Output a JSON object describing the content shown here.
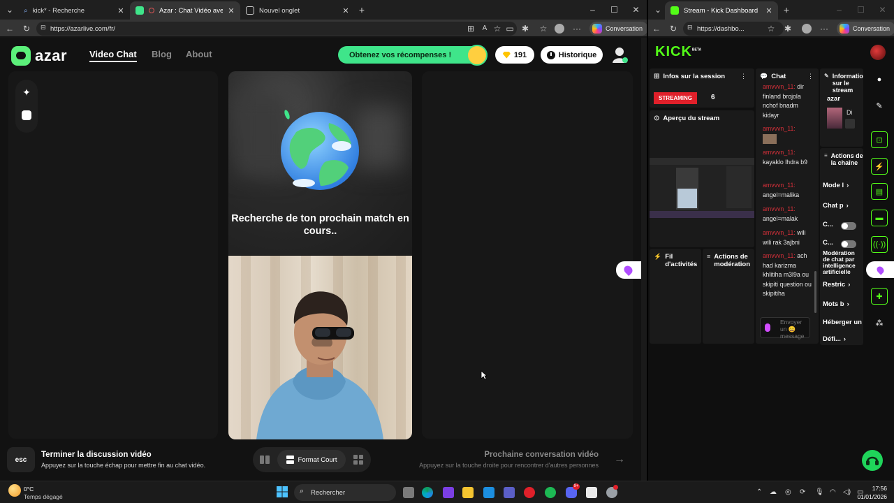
{
  "left_browser": {
    "tabs": [
      {
        "title": "kick* - Recherche",
        "active": false
      },
      {
        "title": "Azar : Chat Vidéo avec de no",
        "active": true
      },
      {
        "title": "Nouvel onglet",
        "active": false
      }
    ],
    "url": "https://azarlive.com/fr/",
    "conversation_label": "Conversation"
  },
  "azar": {
    "logo": "azar",
    "nav": [
      "Video Chat",
      "Blog",
      "About"
    ],
    "reward_label": "Obtenez vos récompenses !",
    "gems_count": "191",
    "history_label": "Historique",
    "searching_text": "Recherche de ton prochain match en cours..",
    "esc_key": "esc",
    "end_title": "Terminer la discussion vidéo",
    "end_sub": "Appuyez sur la touche échap pour mettre fin au chat vidéo.",
    "format_label": "Format Court",
    "next_title": "Prochaine conversation vidéo",
    "next_sub": "Appuyez sur la touche droite pour rencontrer d'autres personnes"
  },
  "right_browser": {
    "tab_title": "Stream - Kick Dashboard",
    "url": "https://dashbo...",
    "conversation_label": "Conversation"
  },
  "kick": {
    "logo": "KICK",
    "logo_badge": "BETA",
    "session_title": "Infos sur la session",
    "streaming_badge": "STREAMING",
    "viewers": "6",
    "preview_title": "Aperçu du stream",
    "activity_title": "Fil d'activités",
    "moderation_title": "Actions de modération",
    "chat_title": "Chat",
    "chat_messages": [
      {
        "user": "amvvvn_11:",
        "text": "dir finland brojola nchof bnadm kidayr"
      },
      {
        "user": "amvvvn_11:",
        "text": ""
      },
      {
        "user": "amvvvn_11:",
        "text": "kayaklo lhdra b9"
      },
      {
        "user": "amvvvn_11:",
        "text": "angel=malika"
      },
      {
        "user": "amvvvn_11:",
        "text": "angel=malak"
      },
      {
        "user": "amvvvn_11:",
        "text": "wili wili rak 3ajbni"
      },
      {
        "user": "amvvvn_11:",
        "text": "ach had karizma khlitiha m3l9a ou skipiti question ou skipitiha"
      }
    ],
    "chat_placeholder": "Envoyer un 😀 message",
    "info_title": "Informations sur le stream",
    "info_user": "azar",
    "info_tag": "Di",
    "channel_actions_title": "Actions de la chaîne",
    "channel_actions": [
      "Mode l",
      "Chat p",
      "C...",
      "C...",
      "Modération de chat par intelligence artificielle",
      "Restric",
      "Mots b",
      "Héberger un",
      "Défi..."
    ]
  },
  "taskbar": {
    "weather_temp": "0°C",
    "weather_desc": "Temps dégagé",
    "search_label": "Rechercher",
    "time": "17:56",
    "date": "01/01/2026",
    "notif_badge": "9+"
  }
}
